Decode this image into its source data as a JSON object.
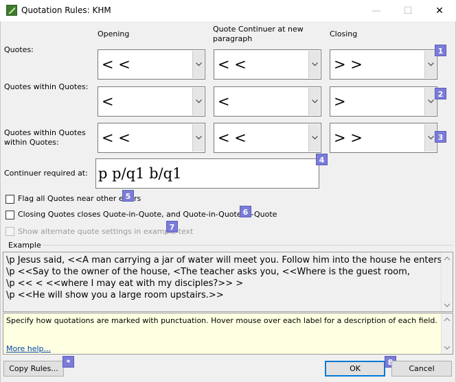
{
  "window": {
    "title": "Quotation Rules: KHM",
    "minimize_icon": "minimize-icon",
    "maximize_icon": "maximize-icon",
    "close_icon": "close-icon",
    "close_glyph": "✕",
    "minimize_glyph": "—",
    "maximize_glyph": "☐"
  },
  "columns": {
    "opening": "Opening",
    "continuer": "Quote Continuer at new paragraph",
    "closing": "Closing"
  },
  "rows": [
    {
      "label": "Quotes:",
      "opening": "< <",
      "continuer": "< <",
      "closing": "> >",
      "badge": "1"
    },
    {
      "label": "Quotes within Quotes:",
      "opening": "<",
      "continuer": "<",
      "closing": ">",
      "badge": "2"
    },
    {
      "label": "Quotes within Quotes within Quotes:",
      "opening": "< <",
      "continuer": "< <",
      "closing": "> >",
      "badge": "3"
    }
  ],
  "continuer_required": {
    "label": "Continuer required at:",
    "value": "p p/q1 b/q1",
    "badge": "4"
  },
  "options": [
    {
      "label": "Flag all Quotes near other errors",
      "badge": "5",
      "checked": false,
      "enabled": true
    },
    {
      "label": "Closing Quotes closes Quote-in-Quote, and Quote-in-Quote-in-Quote",
      "badge": "6",
      "checked": false,
      "enabled": true
    },
    {
      "label": "Show alternate quote settings in example text",
      "badge": "7",
      "checked": false,
      "enabled": false
    }
  ],
  "example": {
    "label": "Example",
    "lines": [
      "\\p Jesus said, <<A man carrying a jar of water will meet you. Follow him into the house he enters.",
      "\\p <<Say to the owner of the house, <The teacher asks you, <<Where is the guest room,",
      "\\p << < <<where I may eat with my disciples?>> >",
      "\\p <<He will show you a large room upstairs.>>"
    ]
  },
  "help": {
    "text": "Specify how quotations are marked with punctuation. Hover mouse over each label for a description of each field.",
    "more_link": "More help..."
  },
  "buttons": {
    "copy_rules": "Copy Rules...",
    "copy_badge": "*",
    "ok": "OK",
    "ok_badge": "8",
    "cancel": "Cancel"
  },
  "colors": {
    "badge": "#7b7bd8",
    "help_background": "#ffffe1",
    "link": "#0645ad",
    "default_button_border": "#0078d7"
  }
}
